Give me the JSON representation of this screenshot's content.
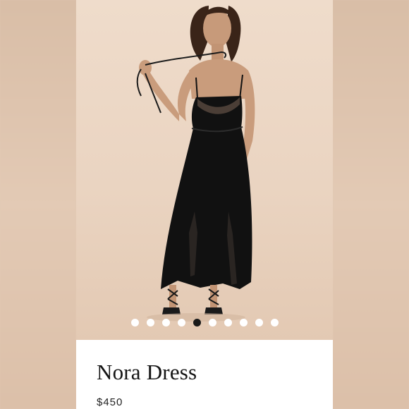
{
  "product": {
    "name": "Nora Dress",
    "price": "$450"
  },
  "carousel": {
    "total_slides": 10,
    "active_index": 4
  },
  "colors": {
    "backdrop": "#e2c9b3",
    "dress": "#111111",
    "active_dot": "#1a1a1a"
  }
}
